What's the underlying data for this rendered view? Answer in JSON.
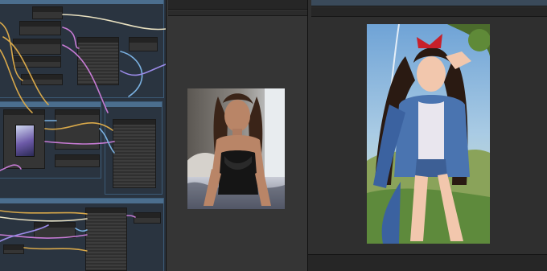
{
  "app": {
    "name": "node-workflow-editor"
  },
  "colors": {
    "graph_bg": "#2a3440",
    "group_border": "#3c5a76",
    "group_header": "#4b6e8e",
    "node_bg": "#353535",
    "panel_bg": "#353535",
    "wire_colors": [
      "#d8a84a",
      "#c77bd4",
      "#7ab0e0",
      "#e8e0c0",
      "#9b8be8"
    ]
  },
  "graph": {
    "groups": [
      "group-top",
      "group-middle-left",
      "group-middle-right",
      "group-bottom"
    ],
    "nodes": [
      "node",
      "node",
      "node",
      "node",
      "node",
      "node",
      "node",
      "node",
      "node",
      "node",
      "node",
      "node",
      "node",
      "node"
    ]
  },
  "panels": {
    "middle": {
      "header": "",
      "image": "image-preview-portrait"
    },
    "right": {
      "header": "",
      "image": "image-preview-anime-character"
    }
  }
}
